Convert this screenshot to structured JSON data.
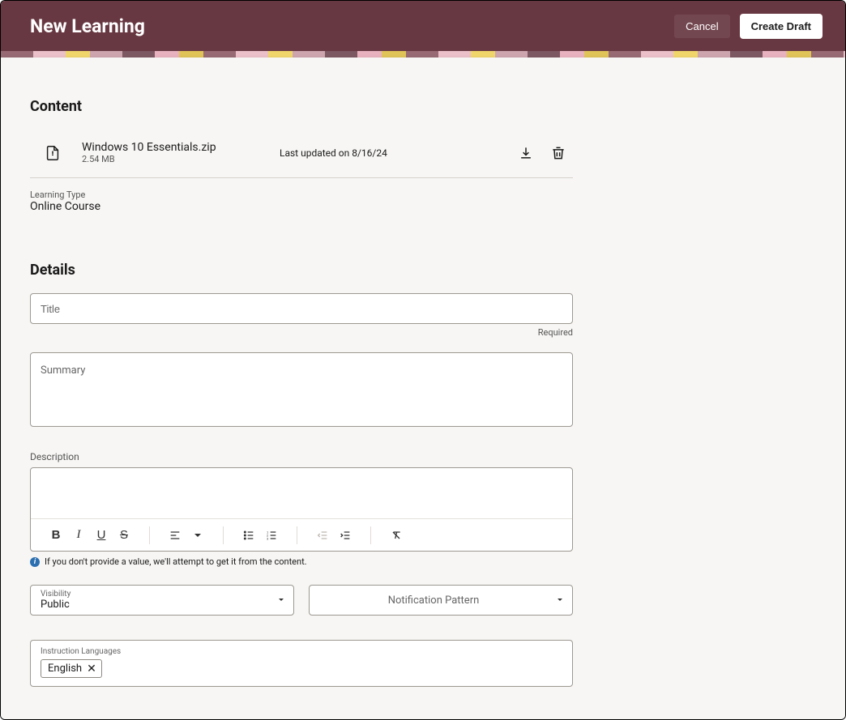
{
  "header": {
    "title": "New Learning",
    "cancel_label": "Cancel",
    "create_label": "Create Draft"
  },
  "content": {
    "section_title": "Content",
    "file": {
      "name": "Windows 10 Essentials.zip",
      "size": "2.54 MB",
      "last_updated": "Last updated on 8/16/24"
    },
    "learning_type_label": "Learning Type",
    "learning_type_value": "Online Course"
  },
  "details": {
    "section_title": "Details",
    "title_placeholder": "Title",
    "title_value": "",
    "title_helper": "Required",
    "summary_placeholder": "Summary",
    "summary_value": "",
    "description_label": "Description",
    "description_value": "",
    "description_info": "If you don't provide a value, we'll attempt to get it from the content.",
    "visibility_label": "Visibility",
    "visibility_value": "Public",
    "notification_placeholder": "Notification Pattern",
    "instruction_languages_label": "Instruction Languages",
    "languages": [
      "English"
    ]
  },
  "icons": {
    "info": "i"
  }
}
